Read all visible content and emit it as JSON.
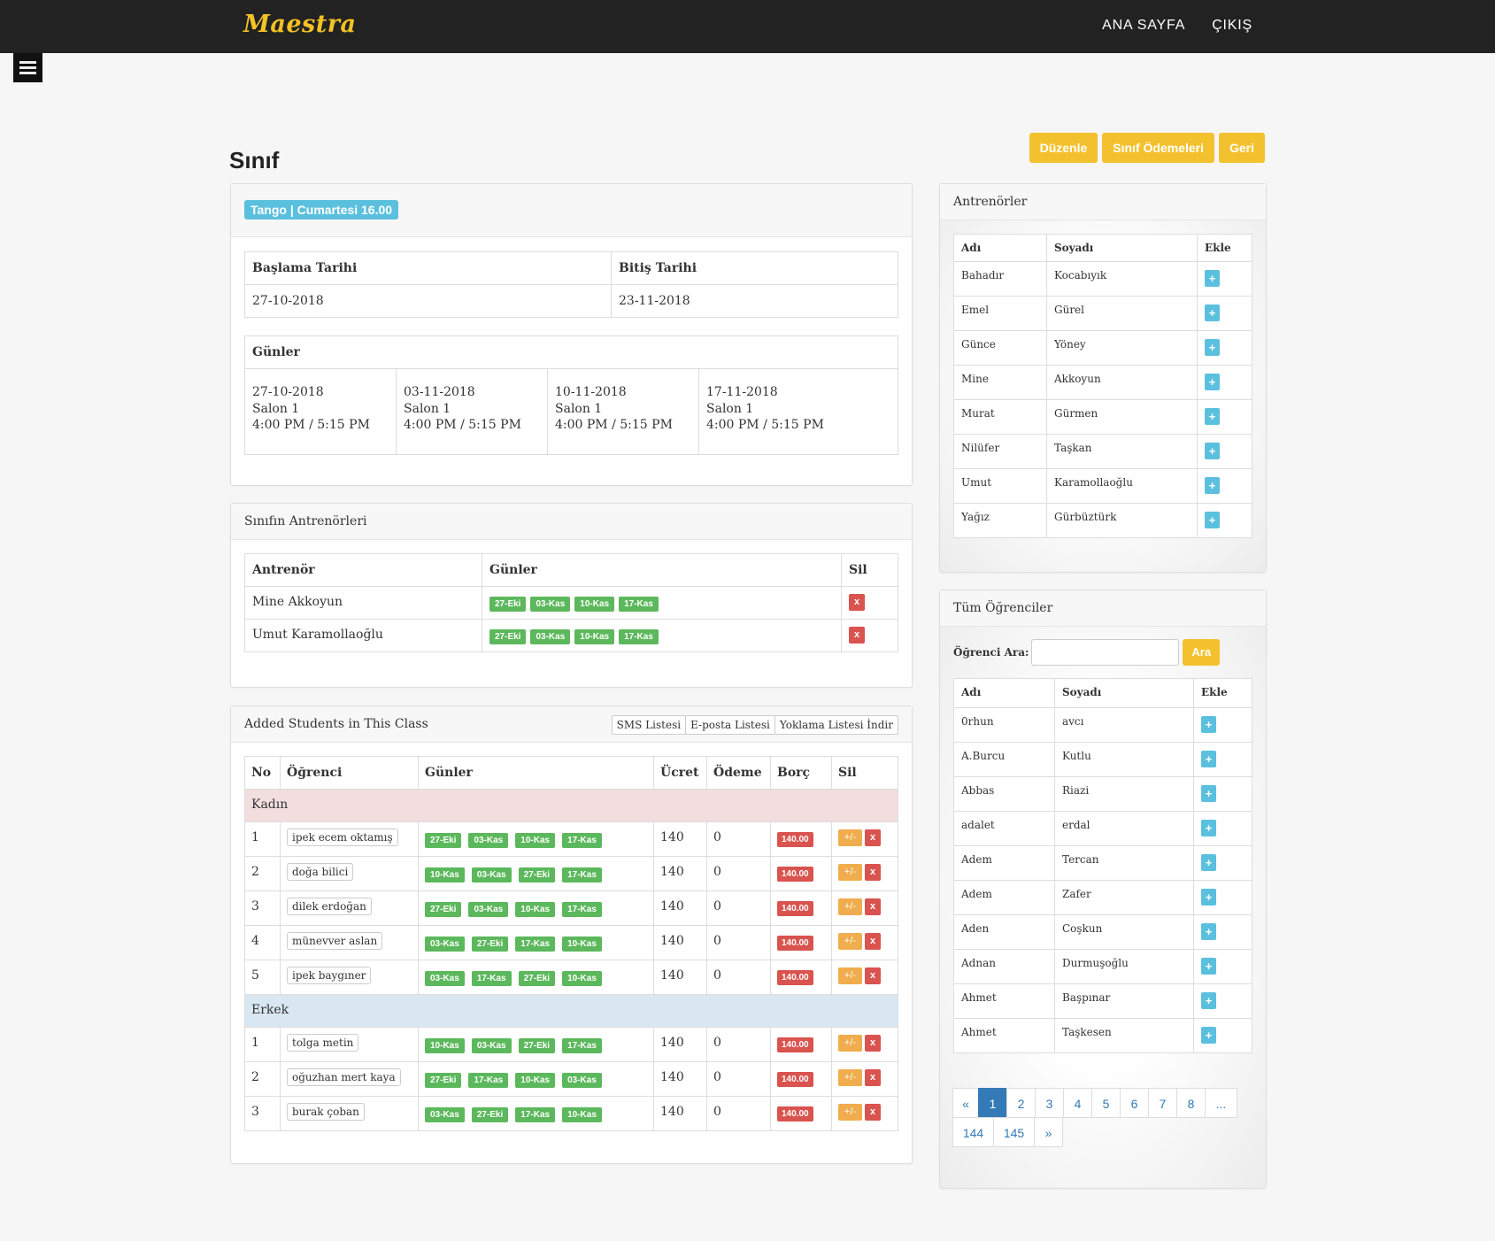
{
  "nav": {
    "brand": "Maestra",
    "home": "ANA SAYFA",
    "logout": "ÇIKIŞ"
  },
  "page": {
    "title": "Sınıf",
    "actions": {
      "edit": "Düzenle",
      "payments": "Sınıf Ödemeleri",
      "back": "Geri"
    }
  },
  "class_info": {
    "label": "Tango | Cumartesi 16.00",
    "start_header": "Başlama Tarihi",
    "end_header": "Bitiş Tarihi",
    "start": "27-10-2018",
    "end": "23-11-2018",
    "days_header": "Günler",
    "sessions": [
      {
        "date": "27-10-2018",
        "room": "Salon 1",
        "time": "4:00 PM / 5:15 PM"
      },
      {
        "date": "03-11-2018",
        "room": "Salon 1",
        "time": "4:00 PM / 5:15 PM"
      },
      {
        "date": "10-11-2018",
        "room": "Salon 1",
        "time": "4:00 PM / 5:15 PM"
      },
      {
        "date": "17-11-2018",
        "room": "Salon 1",
        "time": "4:00 PM / 5:15 PM"
      }
    ]
  },
  "class_trainers": {
    "title": "Sınıfın Antrenörleri",
    "headers": [
      "Antrenör",
      "Günler",
      "Sil"
    ],
    "rows": [
      {
        "name": "Mine Akkoyun",
        "days": [
          "27-Eki",
          "03-Kas",
          "10-Kas",
          "17-Kas"
        ],
        "del": "x"
      },
      {
        "name": "Umut Karamollaoğlu",
        "days": [
          "27-Eki",
          "03-Kas",
          "10-Kas",
          "17-Kas"
        ],
        "del": "x"
      }
    ]
  },
  "students": {
    "title": "Added Students in This Class",
    "buttons": {
      "sms": "SMS Listesi",
      "email": "E-posta Listesi",
      "attendance": "Yoklama Listesi İndir"
    },
    "headers": [
      "No",
      "Öğrenci",
      "Günler",
      "Ücret",
      "Ödeme",
      "Borç",
      "Sil"
    ],
    "groups": [
      {
        "name": "Kadın",
        "rows": [
          {
            "no": "1",
            "name": "ipek ecem oktamış",
            "days": [
              "27-Eki",
              "03-Kas",
              "10-Kas",
              "17-Kas"
            ],
            "fee": "140",
            "paid": "0",
            "debt": "140.00"
          },
          {
            "no": "2",
            "name": "doğa bilici",
            "days": [
              "10-Kas",
              "03-Kas",
              "27-Eki",
              "17-Kas"
            ],
            "fee": "140",
            "paid": "0",
            "debt": "140.00"
          },
          {
            "no": "3",
            "name": "dilek erdoğan",
            "days": [
              "27-Eki",
              "03-Kas",
              "10-Kas",
              "17-Kas"
            ],
            "fee": "140",
            "paid": "0",
            "debt": "140.00"
          },
          {
            "no": "4",
            "name": "münevver aslan",
            "days": [
              "03-Kas",
              "27-Eki",
              "17-Kas",
              "10-Kas"
            ],
            "fee": "140",
            "paid": "0",
            "debt": "140.00"
          },
          {
            "no": "5",
            "name": "ipek baygıner",
            "days": [
              "03-Kas",
              "17-Kas",
              "27-Eki",
              "10-Kas"
            ],
            "fee": "140",
            "paid": "0",
            "debt": "140.00"
          }
        ]
      },
      {
        "name": "Erkek",
        "rows": [
          {
            "no": "1",
            "name": "tolga metin",
            "days": [
              "10-Kas",
              "03-Kas",
              "27-Eki",
              "17-Kas"
            ],
            "fee": "140",
            "paid": "0",
            "debt": "140.00"
          },
          {
            "no": "2",
            "name": "oğuzhan mert kaya",
            "days": [
              "27-Eki",
              "17-Kas",
              "10-Kas",
              "03-Kas"
            ],
            "fee": "140",
            "paid": "0",
            "debt": "140.00"
          },
          {
            "no": "3",
            "name": "burak çoban",
            "days": [
              "03-Kas",
              "27-Eki",
              "17-Kas",
              "10-Kas"
            ],
            "fee": "140",
            "paid": "0",
            "debt": "140.00"
          }
        ]
      }
    ],
    "pm_label": "+/-",
    "del_label": "x"
  },
  "trainers": {
    "title": "Antrenörler",
    "headers": [
      "Adı",
      "Soyadı",
      "Ekle"
    ],
    "rows": [
      {
        "first": "Bahadır",
        "last": "Kocabıyık"
      },
      {
        "first": "Emel",
        "last": "Gürel"
      },
      {
        "first": "Günce",
        "last": "Yöney"
      },
      {
        "first": "Mine",
        "last": "Akkoyun"
      },
      {
        "first": "Murat",
        "last": "Gürmen"
      },
      {
        "first": "Nilüfer",
        "last": "Taşkan"
      },
      {
        "first": "Umut",
        "last": "Karamollaoğlu"
      },
      {
        "first": "Yağız",
        "last": "Gürbüztürk"
      }
    ],
    "add_label": "+"
  },
  "all_students": {
    "title": "Tüm Öğrenciler",
    "search_label": "Öğrenci Ara:",
    "search_value": "",
    "search_button": "Ara",
    "headers": [
      "Adı",
      "Soyadı",
      "Ekle"
    ],
    "rows": [
      {
        "first": "0rhun",
        "last": "avcı"
      },
      {
        "first": "A.Burcu",
        "last": "Kutlu"
      },
      {
        "first": "Abbas",
        "last": "Riazi"
      },
      {
        "first": "adalet",
        "last": "erdal"
      },
      {
        "first": "Adem",
        "last": "Tercan"
      },
      {
        "first": "Adem",
        "last": "Zafer"
      },
      {
        "first": "Aden",
        "last": "Coşkun"
      },
      {
        "first": "Adnan",
        "last": "Durmuşoğlu"
      },
      {
        "first": "Ahmet",
        "last": "Başpınar"
      },
      {
        "first": "Ahmet",
        "last": "Taşkesen"
      }
    ],
    "add_label": "+",
    "pagination": [
      "«",
      "1",
      "2",
      "3",
      "4",
      "5",
      "6",
      "7",
      "8",
      "...",
      "144",
      "145",
      "»"
    ],
    "active_page": "1"
  },
  "colors": {
    "accent": "#f4c12e",
    "info": "#5bc0de",
    "success": "#5cb85c",
    "danger": "#d9534f",
    "warning": "#f0ad4e",
    "female_row": "#f2dede",
    "male_row": "#d9e7f3"
  }
}
